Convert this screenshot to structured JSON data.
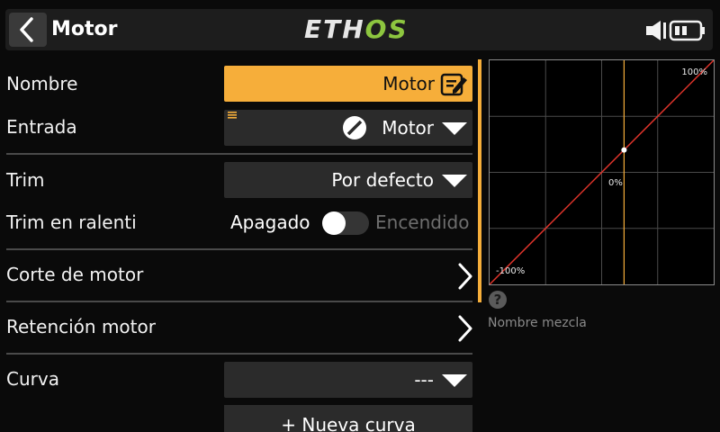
{
  "header": {
    "back_icon": "chevron-left-icon",
    "title": "Motor",
    "logo": {
      "part1": "ETH",
      "part2": "OS"
    },
    "status_icons": [
      "speaker-icon",
      "battery-icon"
    ]
  },
  "form": {
    "name": {
      "label": "Nombre",
      "value": "Motor",
      "icon": "edit-icon"
    },
    "input": {
      "label": "Entrada",
      "value": "Motor",
      "icon": "slider-source-icon"
    },
    "trim": {
      "label": "Trim",
      "value": "Por defecto"
    },
    "idle_trim": {
      "label": "Trim en ralenti",
      "off_label": "Apagado",
      "on_label": "Encendido",
      "state": "off"
    },
    "motor_cut": {
      "label": "Corte de motor"
    },
    "motor_hold": {
      "label": "Retención motor"
    },
    "curve": {
      "label": "Curva",
      "value": "---",
      "new_curve_label": "+ Nueva curva"
    }
  },
  "preview": {
    "tick_top": "100%",
    "tick_mid": "0%",
    "tick_bottom": "-100%",
    "help_icon": "?",
    "mix_name": "Nombre mezcla"
  },
  "colors": {
    "accent": "#f6ae3a",
    "logo_green": "#8dc63f",
    "curve_line": "#e0342b"
  },
  "chart_data": {
    "type": "line",
    "x": [
      -100,
      100
    ],
    "series": [
      {
        "values": [
          -100,
          100
        ]
      }
    ],
    "current_point": {
      "x": 20,
      "y": 20
    },
    "xlim": [
      -100,
      100
    ],
    "ylim": [
      -100,
      100
    ],
    "grid": true
  }
}
